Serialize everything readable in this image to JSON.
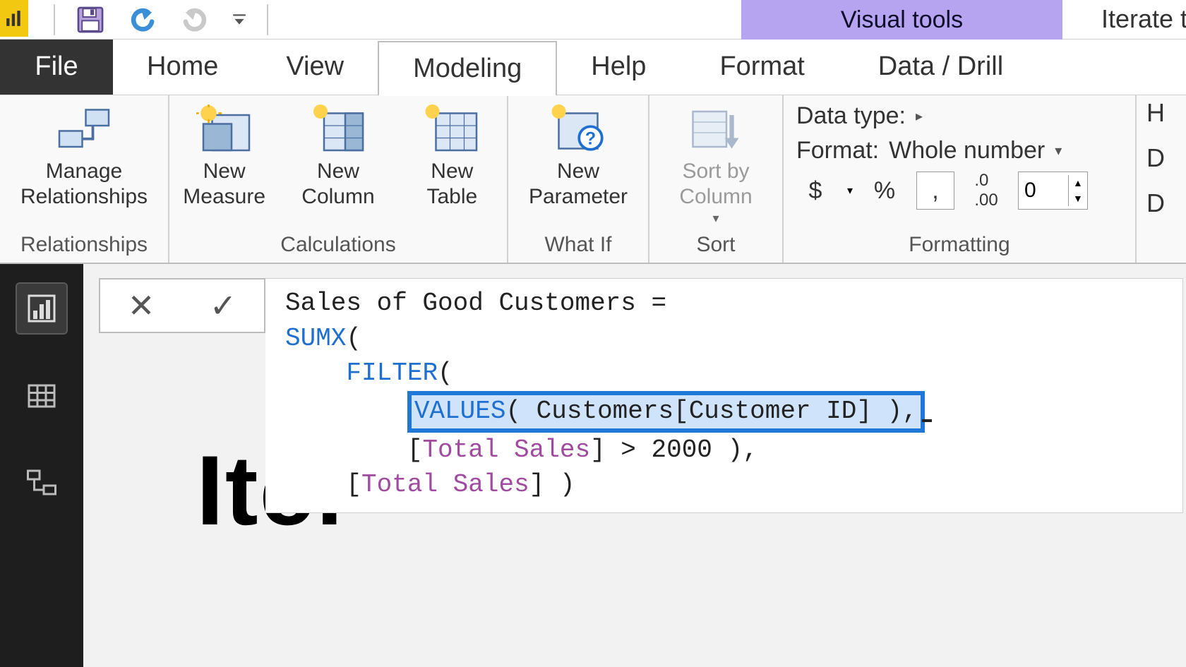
{
  "titlebar": {
    "context_tab": "Visual tools",
    "doc_title": "Iterate t"
  },
  "tabs": {
    "file": "File",
    "home": "Home",
    "view": "View",
    "modeling": "Modeling",
    "help": "Help",
    "format": "Format",
    "datadrill": "Data / Drill"
  },
  "ribbon": {
    "relationships": {
      "manage": "Manage\nRelationships",
      "group": "Relationships"
    },
    "calculations": {
      "new_measure": "New\nMeasure",
      "new_column": "New\nColumn",
      "new_table": "New\nTable",
      "group": "Calculations"
    },
    "whatif": {
      "new_parameter": "New\nParameter",
      "group": "What If"
    },
    "sort": {
      "sort_by_column": "Sort by\nColumn",
      "group": "Sort"
    },
    "formatting": {
      "datatype_label": "Data type:",
      "format_label": "Format:",
      "format_value": "Whole number",
      "decimals": "0",
      "group": "Formatting"
    },
    "right_letters": {
      "a": "H",
      "b": "D",
      "c": "D"
    }
  },
  "formula": {
    "line1_a": "Sales of Good Customers =",
    "sumx": "SUMX",
    "filter": "FILTER",
    "values": "VALUES",
    "values_arg": " Customers[Customer ID] ),",
    "total_sales": "Total Sales",
    "cond_tail": " > 2000 ),",
    "close": " )"
  },
  "bgword": "Iter",
  "icons": {
    "save": "save-icon",
    "undo": "undo-icon",
    "redo": "redo-icon"
  }
}
